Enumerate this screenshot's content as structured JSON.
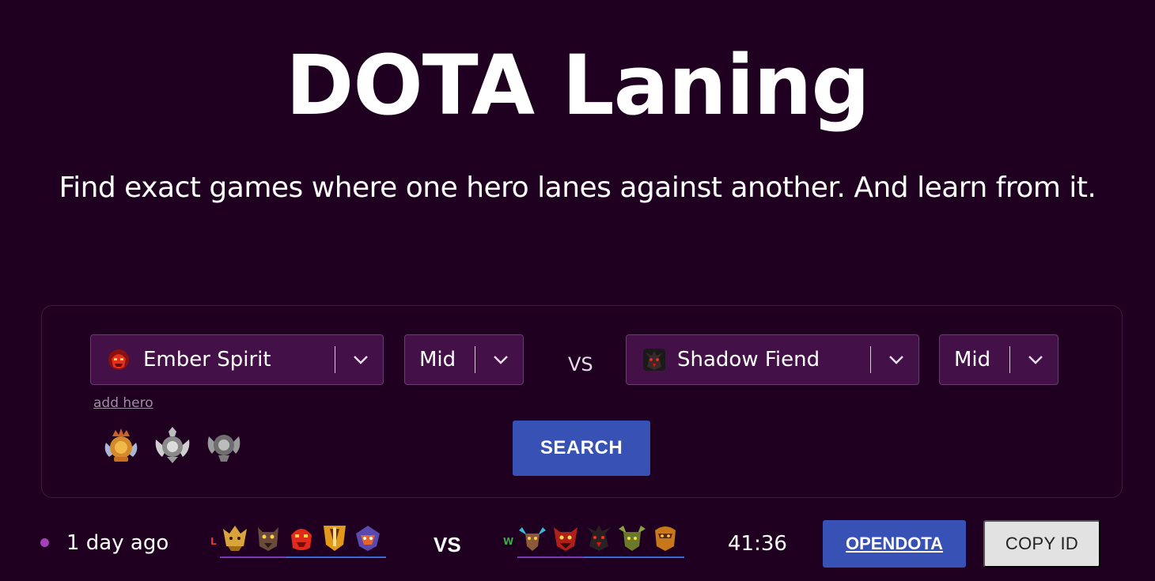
{
  "header": {
    "title": "DOTA Laning",
    "subtitle": "Find exact games where one hero lanes against another. And learn from it."
  },
  "search": {
    "hero1": {
      "name": "Ember Spirit",
      "icon": "ember-spirit-icon"
    },
    "lane1": "Mid",
    "vs_label": "VS",
    "hero2": {
      "name": "Shadow Fiend",
      "icon": "shadow-fiend-icon"
    },
    "lane2": "Mid",
    "add_hero_label": "add hero",
    "search_label": "SEARCH",
    "ranks": [
      "immortal-rank-icon",
      "divine-rank-icon",
      "ancient-rank-icon"
    ]
  },
  "results": [
    {
      "time_ago": "1 day ago",
      "left_team": {
        "result": "L",
        "result_color": "#e23b3b",
        "heroes": [
          "hero-icon-gold",
          "hero-icon-brown",
          "ember-spirit-icon",
          "hero-icon-orange",
          "hero-icon-purple"
        ]
      },
      "vs_label": "VS",
      "right_team": {
        "result": "W",
        "result_color": "#3aa84b",
        "heroes": [
          "hero-icon-teal",
          "hero-icon-red",
          "shadow-fiend-icon",
          "hero-icon-green",
          "hero-icon-amber"
        ]
      },
      "duration": "41:36",
      "opendota_label": "OPENDOTA",
      "copy_label": "COPY ID"
    }
  ],
  "colors": {
    "background": "#1f0021",
    "select_bg": "#431147",
    "button_blue": "#3851b5",
    "dot": "#a83fbf"
  }
}
